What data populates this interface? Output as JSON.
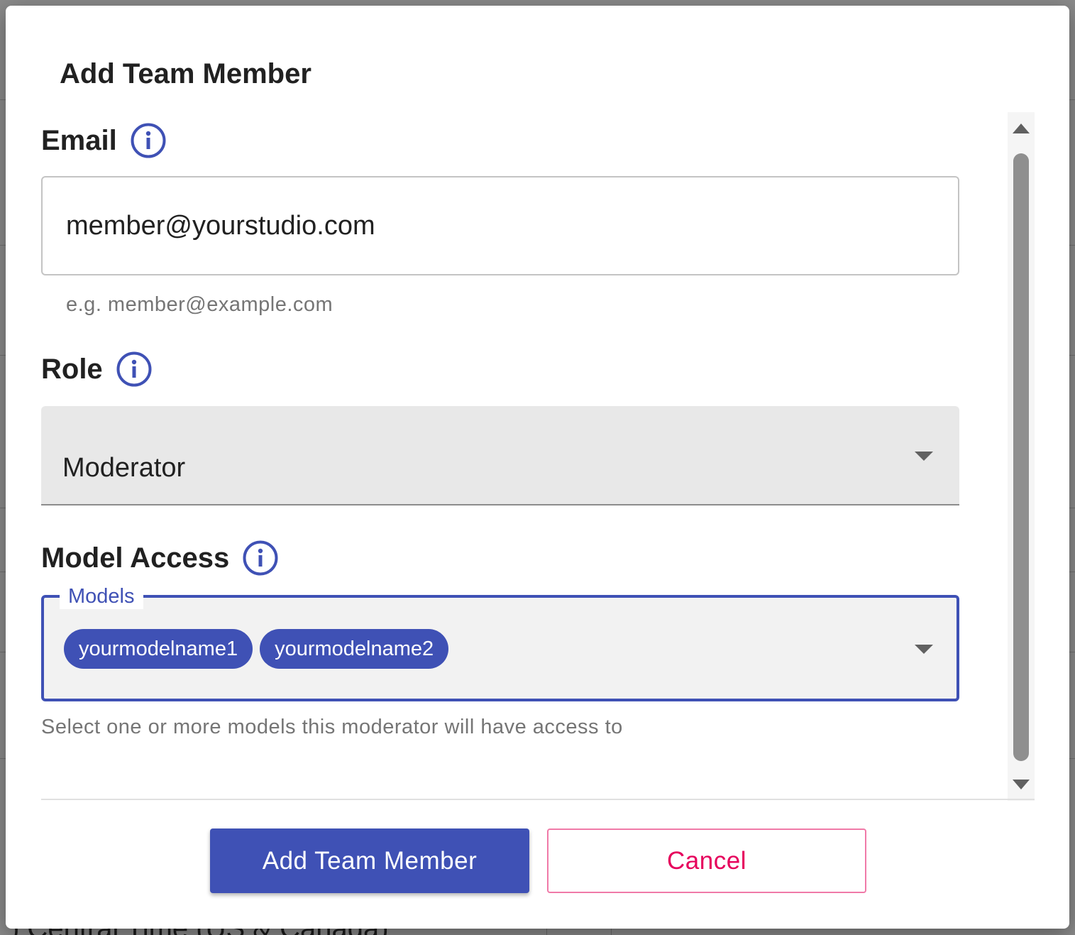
{
  "background": {
    "partial_text": ") Central Time (US & Canada)"
  },
  "dialog": {
    "title": "Add Team Member",
    "email": {
      "label": "Email",
      "value": "member@yourstudio.com",
      "helper": "e.g. member@example.com",
      "icon": "info-icon"
    },
    "role": {
      "label": "Role",
      "selected": "Moderator",
      "icon": "info-icon"
    },
    "model_access": {
      "label": "Model Access",
      "field_label": "Models",
      "chips": [
        "yourmodelname1",
        "yourmodelname2"
      ],
      "helper": "Select one or more models this moderator will have access to",
      "icon": "info-icon"
    },
    "actions": {
      "primary": "Add Team Member",
      "secondary": "Cancel"
    }
  },
  "colors": {
    "accent": "#3f51b5",
    "danger": "#e6005c",
    "overlay": "#8a8a8a"
  }
}
